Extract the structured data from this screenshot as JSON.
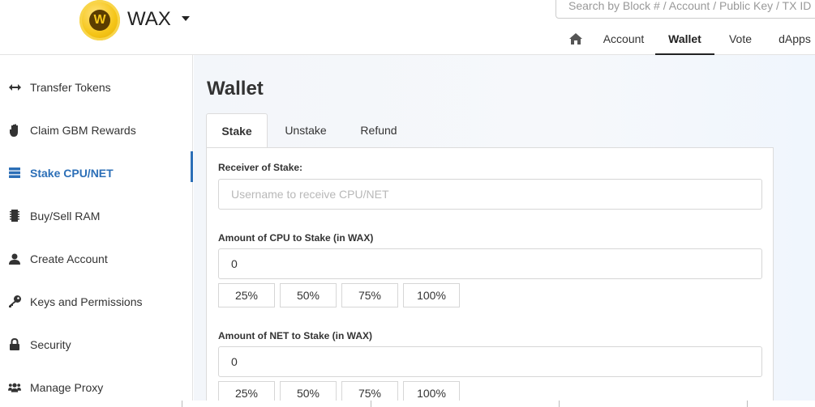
{
  "header": {
    "brand": "WAX",
    "logo_glyph": "W",
    "search_placeholder": "Search by Block # / Account / Public Key / TX ID",
    "nav": [
      {
        "label": ""
      },
      {
        "label": "Account"
      },
      {
        "label": "Wallet"
      },
      {
        "label": "Vote"
      },
      {
        "label": "dApps"
      }
    ]
  },
  "sidebar": {
    "items": [
      {
        "label": "Transfer Tokens",
        "icon": "transfer-arrows-icon"
      },
      {
        "label": "Claim GBM Rewards",
        "icon": "hand-icon"
      },
      {
        "label": "Stake CPU/NET",
        "icon": "server-icon"
      },
      {
        "label": "Buy/Sell RAM",
        "icon": "memory-chip-icon"
      },
      {
        "label": "Create Account",
        "icon": "user-icon"
      },
      {
        "label": "Keys and Permissions",
        "icon": "key-icon"
      },
      {
        "label": "Security",
        "icon": "lock-icon"
      },
      {
        "label": "Manage Proxy",
        "icon": "users-icon"
      }
    ],
    "active_index": 2
  },
  "main": {
    "title": "Wallet",
    "tabs": [
      {
        "label": "Stake"
      },
      {
        "label": "Unstake"
      },
      {
        "label": "Refund"
      }
    ],
    "form": {
      "receiver_label": "Receiver of Stake:",
      "receiver_placeholder": "Username to receive CPU/NET",
      "cpu_label": "Amount of CPU to Stake (in WAX)",
      "cpu_value": "0",
      "net_label": "Amount of NET to Stake (in WAX)",
      "net_value": "0",
      "percent_options": [
        "25%",
        "50%",
        "75%",
        "100%"
      ]
    }
  },
  "colors": {
    "accent": "#2c6fb7",
    "logo_gold": "#f5c518"
  }
}
